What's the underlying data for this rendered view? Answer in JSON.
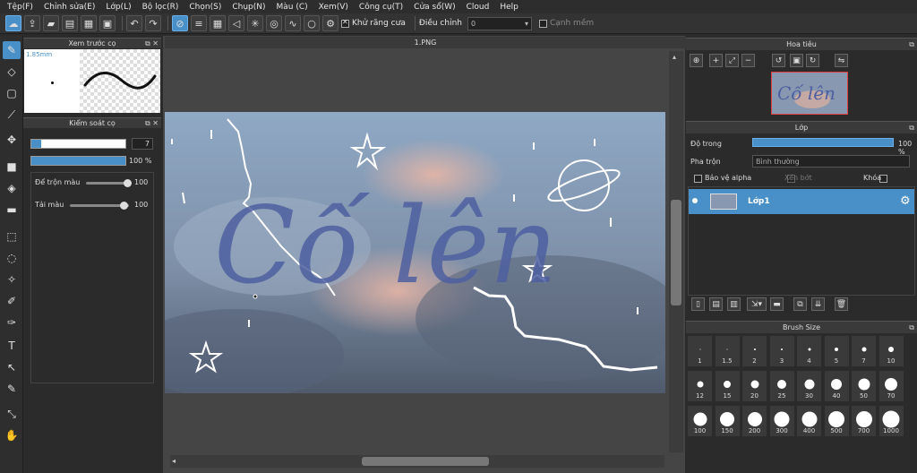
{
  "menu": [
    "Tệp(F)",
    "Chỉnh sửa(E)",
    "Lớp(L)",
    "Bộ lọc(R)",
    "Chọn(S)",
    "Chụp(N)",
    "Màu (C)",
    "Xem(V)",
    "Công cụ(T)",
    "Cửa sổ(W)",
    "Cloud",
    "Help"
  ],
  "toolbar": {
    "antialias_label": "Khử răng cưa",
    "antialias_checked": true,
    "adjust_label": "Điều chỉnh",
    "adjust_value": "0",
    "edge_label": "Cạnh mềm",
    "edge_checked": false
  },
  "brush_preview": {
    "title": "Xem trước cọ",
    "size": "1.85mm"
  },
  "brush_control": {
    "title": "Kiểm soát cọ",
    "size_value": "7",
    "size_fraction": 0.1,
    "opacity_value": "100 %",
    "opacity_fraction": 1.0,
    "mix_label": "Để trộn màu",
    "mix_value": "100",
    "amount_label": "Tải màu",
    "amount_value": "100"
  },
  "document": {
    "tab": "1.PNG",
    "artwork_text": "Cố lên"
  },
  "navigator": {
    "title": "Hoa tiêu"
  },
  "layers": {
    "title": "Lớp",
    "opacity_label": "Độ trong",
    "opacity_value": "100 %",
    "blend_label": "Pha trộn",
    "blend_value": "Bình thường",
    "protect_alpha": "Bảo vệ alpha",
    "clip": "Xén bớt",
    "lock": "Khóa",
    "items": [
      {
        "name": "Lớp1"
      }
    ]
  },
  "brush_size": {
    "title": "Brush Size",
    "sizes": [
      "1",
      "1.5",
      "2",
      "3",
      "4",
      "5",
      "7",
      "10",
      "12",
      "15",
      "20",
      "25",
      "30",
      "40",
      "50",
      "70",
      "100",
      "150",
      "200",
      "300",
      "400",
      "500",
      "700",
      "1000"
    ]
  },
  "colors": {
    "accent": "#4a90c8",
    "handwriting": "#4d5fa0"
  }
}
